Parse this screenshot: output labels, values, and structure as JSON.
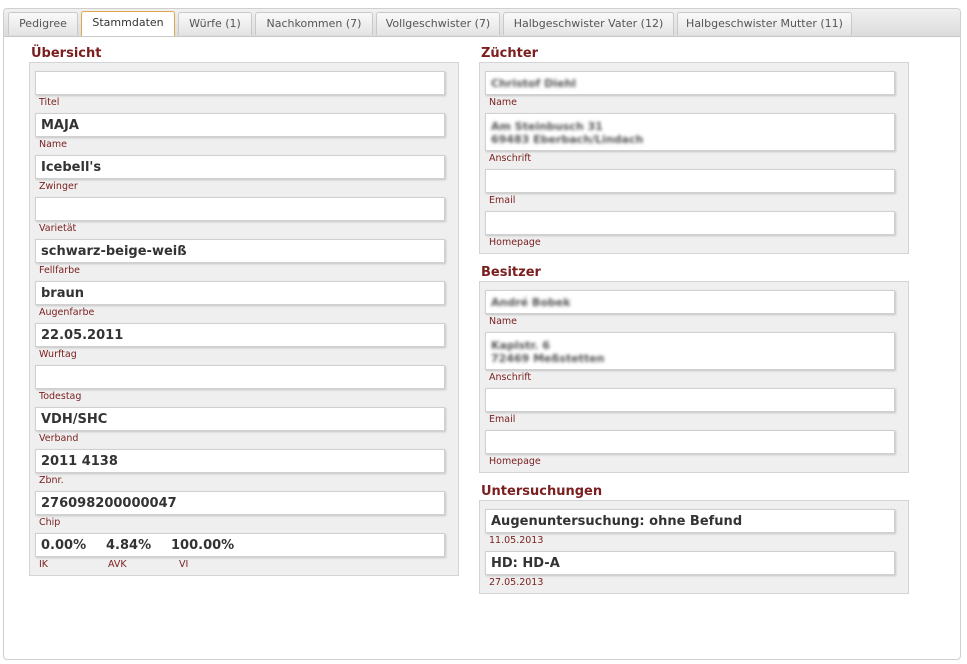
{
  "tabs": [
    {
      "label": "Pedigree"
    },
    {
      "label": "Stammdaten"
    },
    {
      "label": "Würfe (1)"
    },
    {
      "label": "Nachkommen (7)"
    },
    {
      "label": "Vollgeschwister (7)"
    },
    {
      "label": "Halbgeschwister Vater (12)"
    },
    {
      "label": "Halbgeschwister Mutter (11)"
    }
  ],
  "uebersicht": {
    "title": "Übersicht",
    "fields": [
      {
        "value": "",
        "label": "Titel"
      },
      {
        "value": "MAJA",
        "label": "Name"
      },
      {
        "value": "Icebell's",
        "label": "Zwinger"
      },
      {
        "value": "",
        "label": "Varietät"
      },
      {
        "value": "schwarz-beige-weiß",
        "label": "Fellfarbe"
      },
      {
        "value": "braun",
        "label": "Augenfarbe"
      },
      {
        "value": "22.05.2011",
        "label": "Wurftag"
      },
      {
        "value": "",
        "label": "Todestag"
      },
      {
        "value": "VDH/SHC",
        "label": "Verband"
      },
      {
        "value": "2011 4138",
        "label": "Zbnr."
      },
      {
        "value": "276098200000047",
        "label": "Chip"
      }
    ],
    "stats": {
      "ik_value": "0.00%",
      "avk_value": "4.84%",
      "vi_value": "100.00%",
      "ik_label": "IK",
      "avk_label": "AVK",
      "vi_label": "VI"
    }
  },
  "zuechter": {
    "title": "Züchter",
    "name": "Christof Diehl",
    "name_label": "Name",
    "address_line1": "Am Steinbusch 31",
    "address_line2": "69483 Eberbach/Lindach",
    "address_label": "Anschrift",
    "email": "",
    "email_label": "Email",
    "homepage": "",
    "homepage_label": "Homepage"
  },
  "besitzer": {
    "title": "Besitzer",
    "name": "André Bobek",
    "name_label": "Name",
    "address_line1": "Kaplstr. 6",
    "address_line2": "72469 Meßstetten",
    "address_label": "Anschrift",
    "email": "",
    "email_label": "Email",
    "homepage": "",
    "homepage_label": "Homepage"
  },
  "untersuchungen": {
    "title": "Untersuchungen",
    "items": [
      {
        "value": "Augenuntersuchung: ohne Befund",
        "date": "11.05.2013"
      },
      {
        "value": "HD: HD-A",
        "date": "27.05.2013"
      }
    ]
  }
}
